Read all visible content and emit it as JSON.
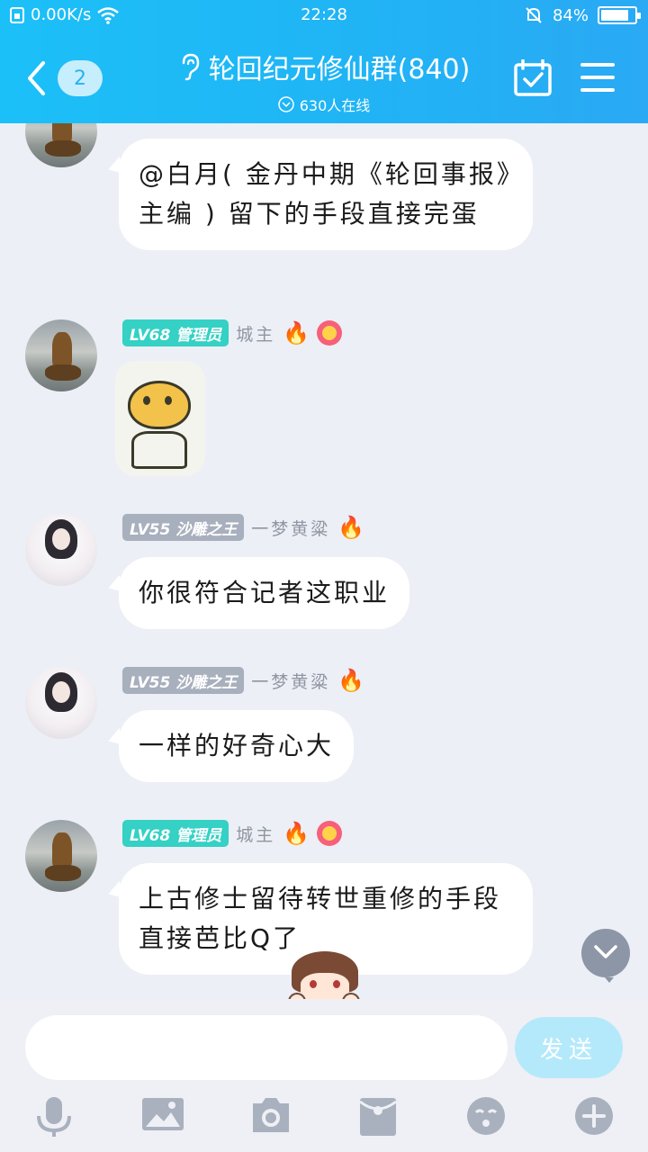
{
  "status_bar": {
    "net_speed": "0.00K/s",
    "time": "22:28",
    "battery": "84%",
    "battery_level": 0.84
  },
  "header": {
    "back_count": "2",
    "group_title": "轮回纪元修仙群(840)",
    "online_text": "630人在线"
  },
  "messages": [
    {
      "type": "text",
      "text": "@白月( 金丹中期《轮回事报》主编 ) 留下的手段直接完蛋"
    },
    {
      "type": "sticker",
      "badge": "LV68 管理员",
      "nickname": "城主",
      "icon": "sticker-face"
    },
    {
      "type": "text",
      "badge": "LV55 沙雕之王",
      "nickname": "一梦黄粱",
      "text": "你很符合记者这职业"
    },
    {
      "type": "text",
      "badge": "LV55 沙雕之王",
      "nickname": "一梦黄粱",
      "text": "一样的好奇心大"
    },
    {
      "type": "text",
      "badge": "LV68 管理员",
      "nickname": "城主",
      "text": "上古修士留待转世重修的手段直接芭比Q了"
    }
  ],
  "input": {
    "placeholder": "",
    "send_label": "发送"
  },
  "toolbar_icons": [
    "microphone-icon",
    "image-icon",
    "camera-icon",
    "red-packet-icon",
    "emoji-icon",
    "plus-icon"
  ],
  "colors": {
    "header": "#1cc0f8",
    "badge_admin": "#34d1c4",
    "badge_member": "#a8afbd",
    "send_button": "#b4e9fb",
    "toolbar_icon": "#a9b0be"
  }
}
